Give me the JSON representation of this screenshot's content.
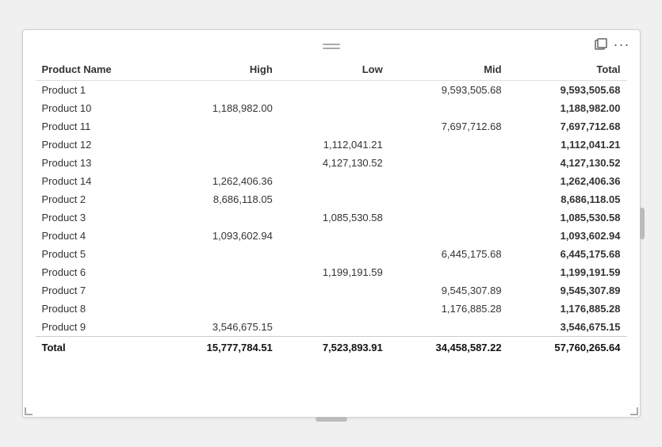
{
  "table": {
    "columns": [
      {
        "key": "product",
        "label": "Product Name",
        "align": "left"
      },
      {
        "key": "high",
        "label": "High",
        "align": "right"
      },
      {
        "key": "low",
        "label": "Low",
        "align": "right"
      },
      {
        "key": "mid",
        "label": "Mid",
        "align": "right"
      },
      {
        "key": "total",
        "label": "Total",
        "align": "right"
      }
    ],
    "rows": [
      {
        "product": "Product 1",
        "high": "",
        "low": "",
        "mid": "9,593,505.68",
        "total": "9,593,505.68"
      },
      {
        "product": "Product 10",
        "high": "1,188,982.00",
        "low": "",
        "mid": "",
        "total": "1,188,982.00"
      },
      {
        "product": "Product 11",
        "high": "",
        "low": "",
        "mid": "7,697,712.68",
        "total": "7,697,712.68"
      },
      {
        "product": "Product 12",
        "high": "",
        "low": "1,112,041.21",
        "mid": "",
        "total": "1,112,041.21"
      },
      {
        "product": "Product 13",
        "high": "",
        "low": "4,127,130.52",
        "mid": "",
        "total": "4,127,130.52"
      },
      {
        "product": "Product 14",
        "high": "1,262,406.36",
        "low": "",
        "mid": "",
        "total": "1,262,406.36"
      },
      {
        "product": "Product 2",
        "high": "8,686,118.05",
        "low": "",
        "mid": "",
        "total": "8,686,118.05"
      },
      {
        "product": "Product 3",
        "high": "",
        "low": "1,085,530.58",
        "mid": "",
        "total": "1,085,530.58"
      },
      {
        "product": "Product 4",
        "high": "1,093,602.94",
        "low": "",
        "mid": "",
        "total": "1,093,602.94"
      },
      {
        "product": "Product 5",
        "high": "",
        "low": "",
        "mid": "6,445,175.68",
        "total": "6,445,175.68"
      },
      {
        "product": "Product 6",
        "high": "",
        "low": "1,199,191.59",
        "mid": "",
        "total": "1,199,191.59"
      },
      {
        "product": "Product 7",
        "high": "",
        "low": "",
        "mid": "9,545,307.89",
        "total": "9,545,307.89"
      },
      {
        "product": "Product 8",
        "high": "",
        "low": "",
        "mid": "1,176,885.28",
        "total": "1,176,885.28"
      },
      {
        "product": "Product 9",
        "high": "3,546,675.15",
        "low": "",
        "mid": "",
        "total": "3,546,675.15"
      }
    ],
    "footer": {
      "product": "Total",
      "high": "15,777,784.51",
      "low": "7,523,893.91",
      "mid": "34,458,587.22",
      "total": "57,760,265.64"
    }
  },
  "icons": {
    "drag": "drag-handle-icon",
    "expand": "expand-icon",
    "more": "more-options-icon"
  }
}
